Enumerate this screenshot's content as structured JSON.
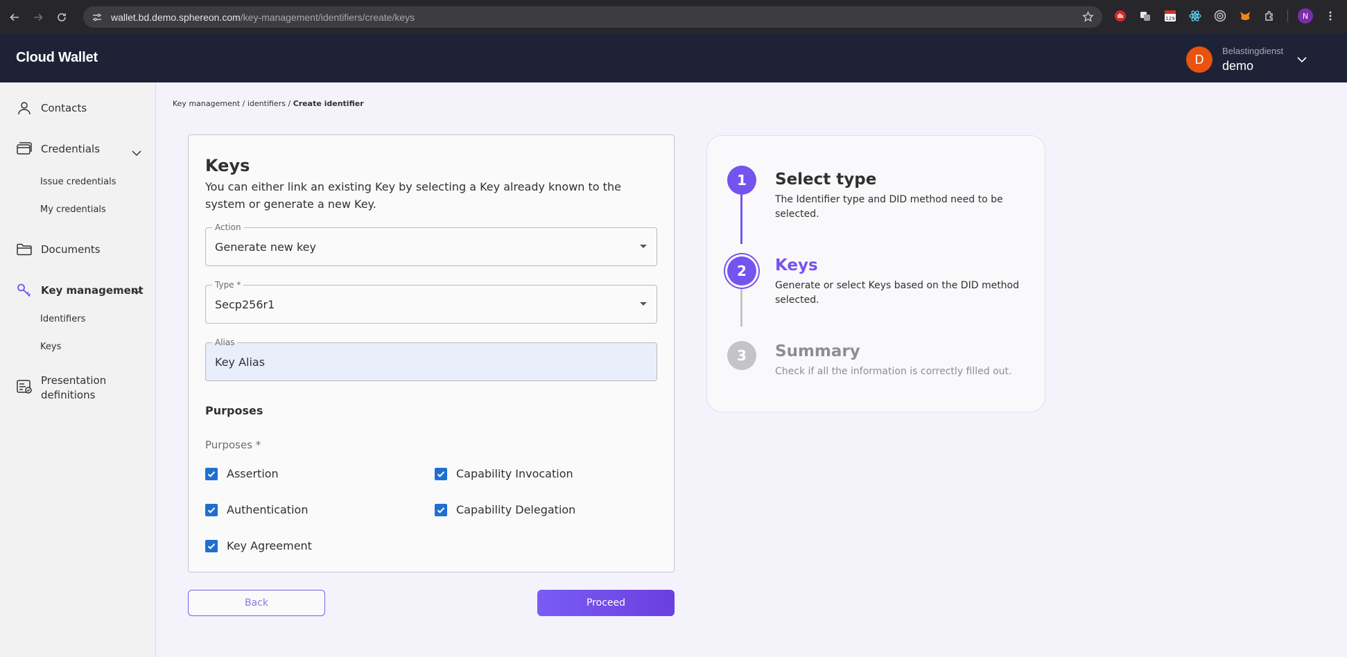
{
  "browser": {
    "url_main": "wallet.bd.demo.sphereon.com",
    "url_path": "/key-management/identifiers/create/keys",
    "badge_count": "129",
    "profile_initial": "N"
  },
  "header": {
    "brand": "Cloud Wallet",
    "user_initial": "D",
    "user_org": "Belastingdienst",
    "user_name": "demo"
  },
  "sidebar": {
    "contacts": "Contacts",
    "credentials": "Credentials",
    "issue_credentials": "Issue credentials",
    "my_credentials": "My credentials",
    "documents": "Documents",
    "key_management": "Key management",
    "identifiers": "Identifiers",
    "keys": "Keys",
    "presentation_line1": "Presentation",
    "presentation_line2": "definitions"
  },
  "breadcrumb": {
    "part1": "Key management",
    "sep": "/",
    "part2": "identifiers",
    "current": "Create identifier"
  },
  "form": {
    "title": "Keys",
    "description": "You can either link an existing Key by selecting a Key already known to the system or generate a new Key.",
    "action_label": "Action",
    "action_value": "Generate new key",
    "type_label": "Type *",
    "type_value": "Secp256r1",
    "alias_label": "Alias",
    "alias_value": "Key Alias",
    "purposes_title": "Purposes",
    "purposes_label": "Purposes *",
    "purposes": {
      "assertion": "Assertion",
      "authentication": "Authentication",
      "key_agreement": "Key Agreement",
      "capability_invocation": "Capability Invocation",
      "capability_delegation": "Capability Delegation"
    },
    "back": "Back",
    "proceed": "Proceed"
  },
  "stepper": {
    "steps": [
      {
        "number": "1",
        "title": "Select type",
        "desc": "The Identifier type and DID method need to be selected.",
        "state": "done"
      },
      {
        "number": "2",
        "title": "Keys",
        "desc": "Generate or select Keys based on the DID method selected.",
        "state": "active"
      },
      {
        "number": "3",
        "title": "Summary",
        "desc": "Check if all the information is correctly filled out.",
        "state": "pending"
      }
    ]
  },
  "colors": {
    "accent": "#7553ef",
    "header_bg": "#1e2236",
    "avatar": "#e9530f",
    "checkbox": "#1f6fd1"
  }
}
